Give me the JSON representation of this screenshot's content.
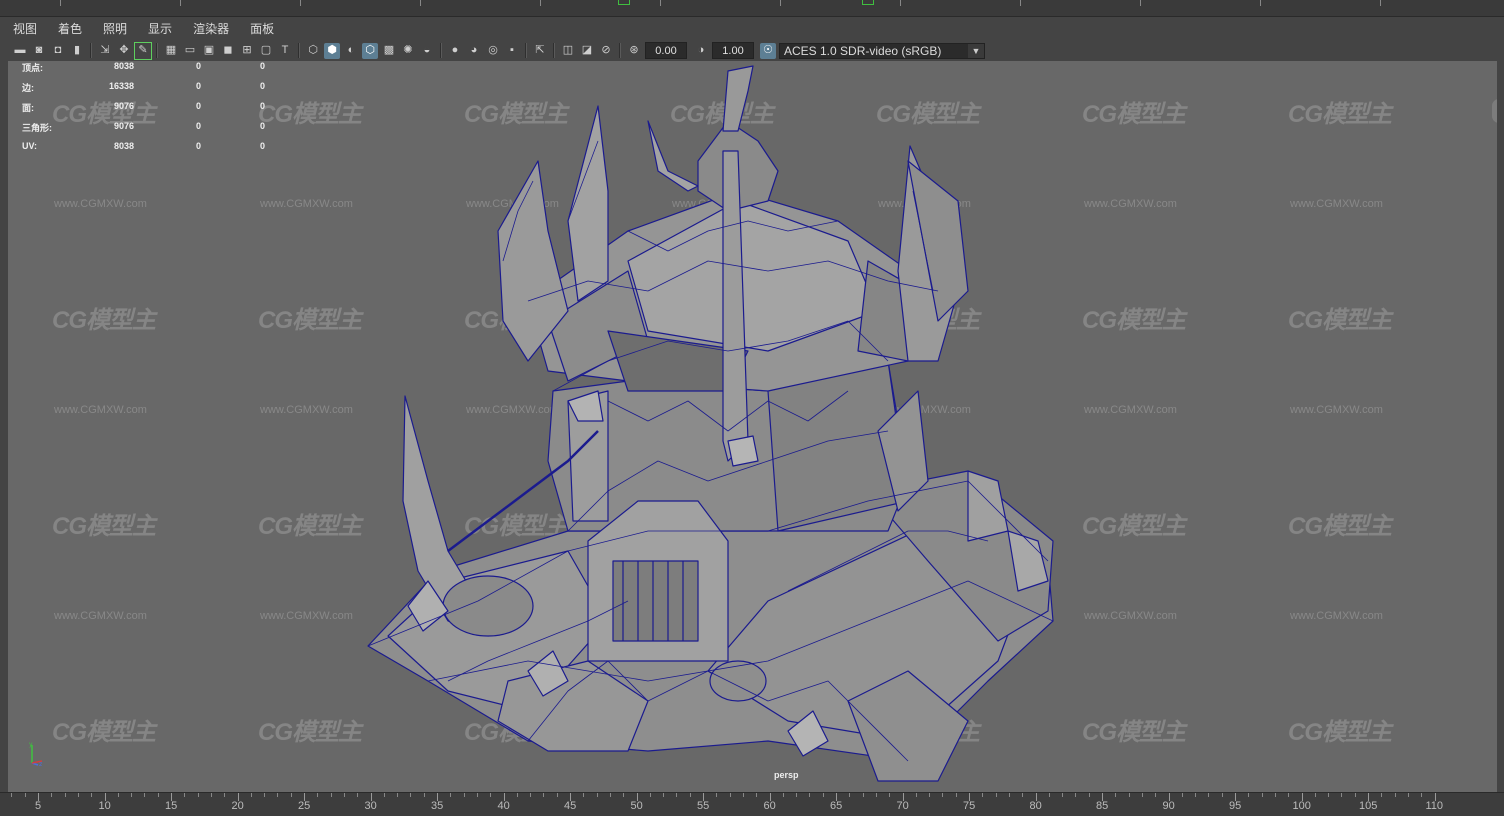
{
  "menu": {
    "items": [
      "视图",
      "着色",
      "照明",
      "显示",
      "渲染器",
      "面板"
    ]
  },
  "toolbar": {
    "exposure_value": "0.00",
    "gamma_value": "1.00",
    "color_space": "ACES 1.0 SDR-video (sRGB)",
    "icons": [
      "select-camera-icon",
      "camera-attributes-icon",
      "bookmark-icon",
      "image-plane-icon",
      "2d-pan-zoom-icon",
      "grease-pencil-icon",
      "grid-icon",
      "film-gate-icon",
      "resolution-gate-icon",
      "gate-mask-icon",
      "field-chart-icon",
      "safe-action-icon",
      "safe-title-icon",
      "wireframe-icon",
      "smooth-shade-icon",
      "default-material-icon",
      "wireframe-on-shaded-icon",
      "textured-icon",
      "use-lights-icon",
      "shadows-icon",
      "screen-space-ao-icon",
      "motion-blur-icon",
      "multisample-aa-icon",
      "depth-of-field-icon",
      "isolate-select-icon",
      "xray-icon",
      "xray-active-icon",
      "xray-joints-icon",
      "backface-culling-icon",
      "exposure-icon",
      "gamma-icon",
      "color-management-icon"
    ]
  },
  "stats": {
    "rows": [
      {
        "label": "顶点:",
        "v1": "8038",
        "v2": "0",
        "v3": "0"
      },
      {
        "label": "边:",
        "v1": "16338",
        "v2": "0",
        "v3": "0"
      },
      {
        "label": "面:",
        "v1": "9076",
        "v2": "0",
        "v3": "0"
      },
      {
        "label": "三角形:",
        "v1": "9076",
        "v2": "0",
        "v3": "0"
      },
      {
        "label": "UV:",
        "v1": "8038",
        "v2": "0",
        "v3": "0"
      }
    ]
  },
  "viewport": {
    "camera_label": "persp",
    "watermark_logo": "CG模型主",
    "watermark_url": "www.CGMXW.com",
    "background_color": "#686868",
    "wire_color": "#1a1a8c"
  },
  "timeline": {
    "ticks": [
      "5",
      "10",
      "15",
      "20",
      "25",
      "30",
      "35",
      "40",
      "45",
      "50",
      "55",
      "60",
      "65",
      "70",
      "75",
      "80",
      "85",
      "90",
      "95",
      "100",
      "105",
      "110"
    ]
  }
}
